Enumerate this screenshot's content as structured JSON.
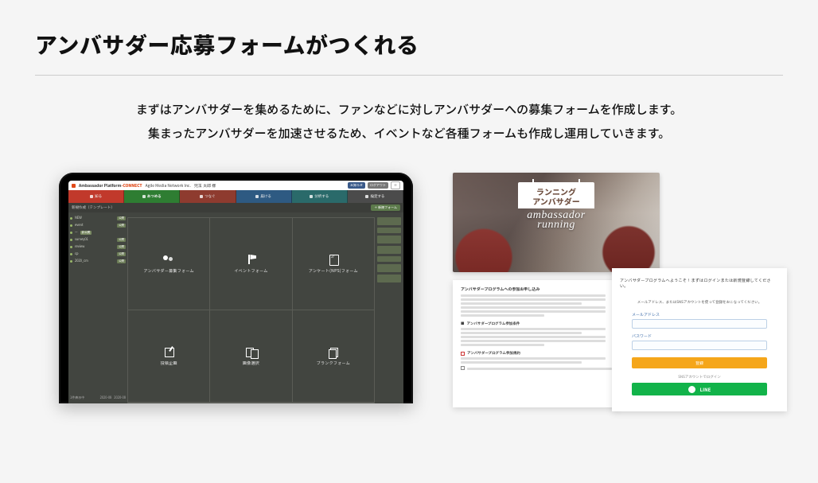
{
  "title": "アンバサダー応募フォームがつくれる",
  "lead_line1": "まずはアンバサダーを集めるために、ファンなどに対しアンバサダーへの募集フォームを作成します。",
  "lead_line2": "集まったアンバサダーを加速させるため、イベントなど各種フォームも作成し運用していきます。",
  "tablet": {
    "brand_prefix": "Ambassador Platform",
    "brand_suffix": "-CONNECT",
    "company": "Agile Media Network Inc.",
    "user": "児玉 太郎 様",
    "header_pill1": "お知らせ",
    "header_pill2": "ログアウト",
    "tabs": [
      {
        "label": "知る",
        "cls": "red"
      },
      {
        "label": "あつめる",
        "cls": "green"
      },
      {
        "label": "つなぐ",
        "cls": "red2"
      },
      {
        "label": "届ける",
        "cls": "blue"
      },
      {
        "label": "分析する",
        "cls": "teal"
      },
      {
        "label": "設定する",
        "cls": "dark"
      }
    ],
    "toolbar_left": "新規作成（テンプレート）",
    "toolbar_btn": "＋ 新規フォーム",
    "cards": [
      {
        "icon": "people",
        "label": "アンバサダー募集フォーム"
      },
      {
        "icon": "flag",
        "label": "イベントフォーム"
      },
      {
        "icon": "check",
        "label": "アンケート(NPS)フォーム"
      },
      {
        "icon": "edit",
        "label": "投稿企画"
      },
      {
        "icon": "image",
        "label": "画像選択"
      },
      {
        "icon": "blank",
        "label": "ブランクフォーム"
      }
    ],
    "left_rows": [
      {
        "t": "NEW",
        "tag": "公開"
      },
      {
        "t": "event",
        "tag": "公開"
      },
      {
        "t": "—",
        "tag": "非公開"
      },
      {
        "t": "survey01",
        "tag": "公開"
      },
      {
        "t": "review",
        "tag": "公開"
      },
      {
        "t": "cp",
        "tag": "公開"
      },
      {
        "t": "2020_cm",
        "tag": "公開"
      }
    ],
    "footer_left": "1件表示中",
    "footer_date1": "2020-08",
    "footer_date2": "2020-08"
  },
  "hero": {
    "line1": "ランニング",
    "line2": "アンバサダー",
    "script1": "ambassador",
    "script2": "running"
  },
  "doc_a": {
    "head1": "アンバサダープログラムへの参加お申し込み",
    "sect1_label": "アンバサダープログラム参加条件",
    "sect2_label": "アンバサダープログラム参加規約"
  },
  "doc_b": {
    "title": "アンバサダープログラムへようこそ！まずはログインまたは新規登録してください。",
    "sub": "メールアドレス、またはSNSアカウントを使って登録をおこなってください。",
    "field1": "メールアドレス",
    "field2": "パスワード",
    "btn_orange": "登録",
    "or_text": "SNSアカウントでログイン",
    "btn_line": "LINE"
  }
}
